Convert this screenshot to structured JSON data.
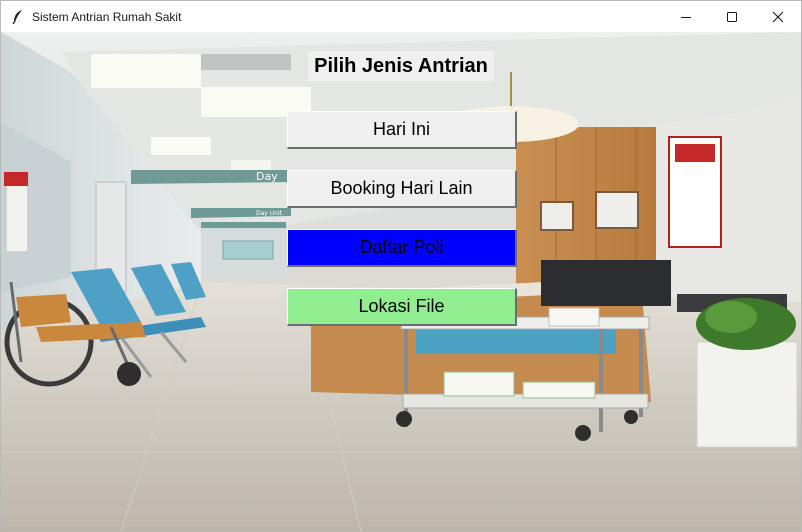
{
  "window": {
    "title": "Sistem Antrian Rumah Sakit",
    "app_icon": "feather-icon",
    "controls": [
      "minimize-icon",
      "maximize-icon",
      "close-icon"
    ]
  },
  "scene": {
    "corridor_sign": "Day",
    "corridor_sign_small": "Day Unit"
  },
  "main": {
    "heading": "Pilih Jenis Antrian",
    "buttons": [
      {
        "label": "Hari Ini",
        "bg": "#f0f0f0"
      },
      {
        "label": "Booking Hari Lain",
        "bg": "#f0f0f0"
      },
      {
        "label": "Daftar Poli",
        "bg": "#0000ff"
      },
      {
        "label": "Lokasi File",
        "bg": "#90ee90"
      }
    ]
  }
}
